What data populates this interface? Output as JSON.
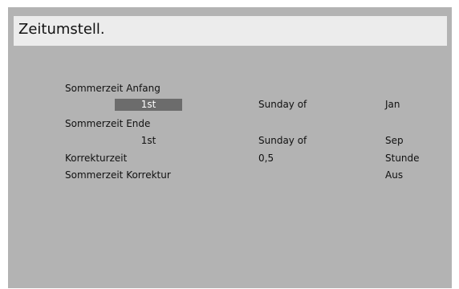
{
  "header": {
    "title": "Zeitumstell."
  },
  "rows": [
    {
      "label": "Sommerzeit Anfang"
    },
    {
      "col1": "1st",
      "col2": "Sunday of",
      "col3": "Jan"
    },
    {
      "label": "Sommerzeit Ende"
    },
    {
      "col1": "1st",
      "col2": "Sunday of",
      "col3": "Sep"
    },
    {
      "label": "Korrekturzeit",
      "col2": "0,5",
      "col3": "Stunde"
    },
    {
      "label": "Sommerzeit Korrektur",
      "col3": "Aus"
    }
  ],
  "colors": {
    "panel": "#b3b3b3",
    "header": "#ececec",
    "selection": "#6c6c6c"
  }
}
